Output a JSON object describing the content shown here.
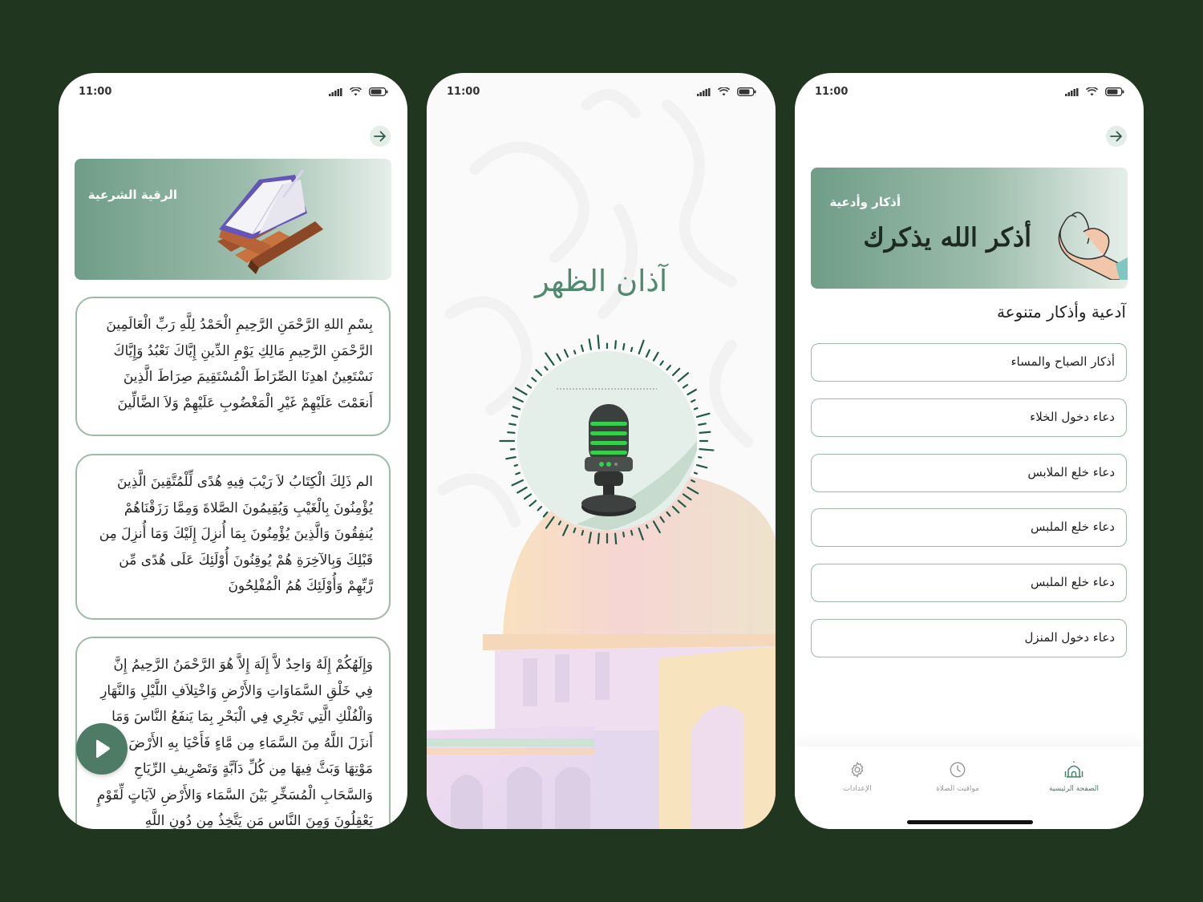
{
  "screen1": {
    "time": "11:00",
    "banner_title": "الرقية الشرعية",
    "verses": [
      "بِسْمِ اللهِ الرَّحْمَنِ الرَّحِيمِ الْحَمْدُ لِلَّهِ رَبِّ الْعَالَمِينَ الرَّحْمَنِ الرَّحِيمِ مَالِكِ يَوْمِ الدِّينِ إِيَّاكَ نَعْبُدُ وَإِيَّاكَ نَسْتَعِينُ اهدِنَا الصِّرَاطَ الْمُسْتَقِيمَ صِرَاطَ الَّذِينَ أَنعَمْتَ عَلَيْهِمْ غَيْرِ الْمَغْضُوبِ عَلَيْهِمْ وَلاَ الضَّالِّينَ",
      "الم ذَلِكَ الْكِتَابُ لاَ رَيْبَ فِيهِ هُدًى لِّلْمُتَّقِينَ الَّذِينَ يُؤْمِنُونَ بِالْغَيْبِ وَيُقِيمُونَ الصَّلاةَ وَمِمَّا رَزَقْنَاهُمْ يُنفِقُونَ وَالَّذِينَ يُؤْمِنُونَ بِمَا أُنزِلَ إِلَيْكَ وَمَا أُنزِلَ مِن قَبْلِكَ وَبِالآخِرَةِ هُمْ يُوقِنُونَ أُوْلَئِكَ عَلَى هُدًى مِّن رَّبِّهِمْ وَأُوْلَئِكَ هُمُ الْمُفْلِحُونَ",
      "وَإِلَهُكُمْ إِلَهٌ وَاحِدٌ لاَّ إِلَهَ إِلاَّ هُوَ الرَّحْمَنُ الرَّحِيمُ إِنَّ فِي خَلْقِ السَّمَاوَاتِ وَالأَرْضِ وَاخْتِلاَفِ اللَّيْلِ وَالنَّهَارِ وَالْفُلْكِ الَّتِي تَجْرِي فِي الْبَحْرِ بِمَا يَنفَعُ النَّاسَ وَمَا أَنزَلَ اللَّهُ مِنَ السَّمَاءِ مِن مَّاءٍ فَأَحْيَا بِهِ الأَرْضَ بَعْدَ مَوْتِهَا وَبَثَّ فِيهَا مِن كُلِّ دَآبَّةٍ وَتَصْرِيفِ الرِّيَاحِ وَالسَّحَابِ الْمُسَخِّرِ بَيْنَ السَّمَاء وَالأَرْضِ لآيَاتٍ لِّقَوْمٍ يَعْقِلُونَ وَمِنَ النَّاسِ مَن يَتَّخِذُ مِن دُونِ اللَّهِ"
    ]
  },
  "screen2": {
    "time": "11:00",
    "adhan_title": "آذان الظهر"
  },
  "screen3": {
    "time": "11:00",
    "banner_title": "أذكار وأدعية",
    "banner_calligraphy": "أذكر الله يذكرك",
    "section_title": "آدعية وأذكار متنوعة",
    "items": [
      "أذكار الصباح والمساء",
      "دعاء دخول الخلاء",
      "دعاء خلع الملابس",
      "دعاء خلع الملبس",
      "دعاء خلع الملبس",
      "دعاء دخول المنزل"
    ],
    "tabs": [
      {
        "label": "الإعدادات",
        "icon": "gear-icon"
      },
      {
        "label": "مواقيت الصلاة",
        "icon": "clock-icon"
      },
      {
        "label": "الصفحة الرئيسية",
        "icon": "mosque-icon"
      }
    ]
  },
  "colors": {
    "background": "#21361f",
    "primary": "#4e7b65",
    "accent_green": "#3f8464",
    "border": "#9dbaa9"
  }
}
